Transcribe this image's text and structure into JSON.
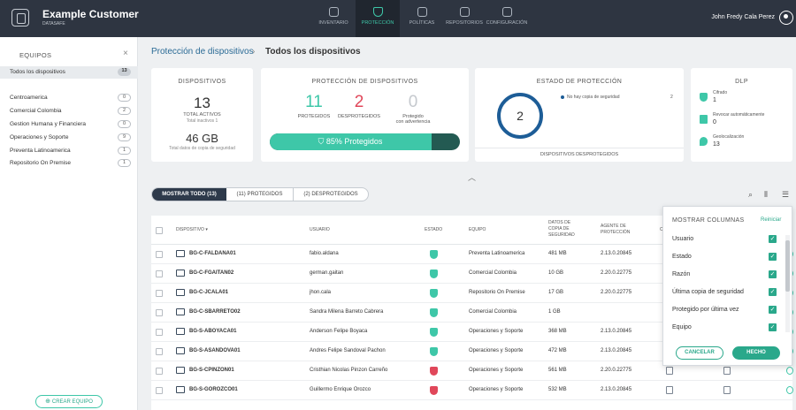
{
  "header": {
    "brand_name": "Example Customer",
    "brand_sub": "DATASAFE",
    "user_name": "John Fredy Cala Perez",
    "nav": [
      {
        "label": "INVENTARIO",
        "icon": "search-icon"
      },
      {
        "label": "PROTECCIÓN",
        "icon": "shield-icon"
      },
      {
        "label": "POLÍTICAS",
        "icon": "document-icon"
      },
      {
        "label": "REPOSITORIOS",
        "icon": "cloud-icon"
      },
      {
        "label": "CONFIGURACIÓN",
        "icon": "gear-icon"
      }
    ]
  },
  "sidebar": {
    "title": "EQUIPOS",
    "all_label": "Todos los dispositivos",
    "all_count": "13",
    "groups": [
      {
        "label": "Centroamerica",
        "count": "0"
      },
      {
        "label": "Comercial Colombia",
        "count": "2"
      },
      {
        "label": "Gestion Humana y Financiera",
        "count": "0"
      },
      {
        "label": "Operaciones y Soporte",
        "count": "9"
      },
      {
        "label": "Preventa Latinoamerica",
        "count": "1"
      },
      {
        "label": "Repositorio On Premise",
        "count": "1"
      }
    ],
    "create_label": "CREAR EQUIPO"
  },
  "breadcrumb": {
    "parent": "Protección de dispositivos",
    "sep": "›",
    "current": "Todos los dispositivos"
  },
  "cards": {
    "devices": {
      "title": "DISPOSITIVOS",
      "total": "13",
      "total_label": "TOTAL ACTIVOS",
      "inactive": "Total inactivos 1",
      "size": "46 GB",
      "size_label": "Total datos de copia de seguridad"
    },
    "protection": {
      "title": "PROTECCIÓN DE DISPOSITIVOS",
      "protected": "11",
      "protected_label": "PROTEGIDOS",
      "unprotected": "2",
      "unprotected_label": "DESPROTEGIDOS",
      "warning": "0",
      "warning_label1": "Protegido",
      "warning_label2": "con advertencia",
      "bar_text": "85% Protegidos",
      "bar_pct": 85
    },
    "state": {
      "title": "ESTADO DE PROTECCIÓN",
      "count": "2",
      "legend": "No hay copia de seguridad",
      "legend_value": "2",
      "footer": "DISPOSITIVOS DESPROTEGIDOS"
    },
    "dlp": {
      "title": "DLP",
      "items": [
        {
          "label": "Cifrado",
          "value": "1"
        },
        {
          "label": "Revocar automáticamente",
          "value": "0"
        },
        {
          "label": "Geolocalización",
          "value": "13"
        }
      ]
    }
  },
  "filters": {
    "tabs": [
      "MOSTRAR TODO (13)",
      "(11) PROTEGIDOS",
      "(2) DESPROTEGIDOS"
    ]
  },
  "table": {
    "headers": {
      "device": "DISPOSITIVO ▾",
      "user": "USUARIO",
      "status": "ESTADO",
      "team": "EQUIPO",
      "backup1": "DATOS DE",
      "backup2": "COPIA DE",
      "backup3": "SEGURIDAD",
      "agent1": "AGENTE DE",
      "agent2": "PROTECCIÓN",
      "extra": "C"
    },
    "rows": [
      {
        "device": "BG-C-FALDANA01",
        "user": "fabio.aldana",
        "status": "ok",
        "team": "Preventa Latinoamerica",
        "size": "481 MB",
        "agent": "2.13.0.20845"
      },
      {
        "device": "BG-C-FGAITAN02",
        "user": "german.gaitan",
        "status": "ok",
        "team": "Comercial Colombia",
        "size": "10 GB",
        "agent": "2.20.0.22775"
      },
      {
        "device": "BG-C-JCALA01",
        "user": "jhon.cala",
        "status": "ok",
        "team": "Repositorio On Premise",
        "size": "17 GB",
        "agent": "2.20.0.22775"
      },
      {
        "device": "BG-C-SBARRETO02",
        "user": "Sandra Milena Barreto Cabrera",
        "status": "ok",
        "team": "Comercial Colombia",
        "size": "1 GB",
        "agent": ""
      },
      {
        "device": "BG-S-ABOYACA01",
        "user": "Anderson Felipe Boyaca",
        "status": "ok",
        "team": "Operaciones y Soporte",
        "size": "368 MB",
        "agent": "2.13.0.20845"
      },
      {
        "device": "BG-S-ASANDOVA01",
        "user": "Andres Felipe Sandoval Pachon",
        "status": "ok",
        "team": "Operaciones y Soporte",
        "size": "472 MB",
        "agent": "2.13.0.20845"
      },
      {
        "device": "BG-S-CPINZON01",
        "user": "Cristhian Nicolas Pinzon Carreño",
        "status": "bad",
        "team": "Operaciones y Soporte",
        "size": "561 MB",
        "agent": "2.20.0.22775"
      },
      {
        "device": "BG-S-GOROZCO01",
        "user": "Guillermo Enrique Orozco",
        "status": "bad",
        "team": "Operaciones y Soporte",
        "size": "532 MB",
        "agent": "2.13.0.20845"
      }
    ]
  },
  "columns_panel": {
    "title": "MOSTRAR COLUMNAS",
    "reset": "Reiniciar",
    "items": [
      "Usuario",
      "Estado",
      "Razón",
      "Última copia de seguridad",
      "Protegido por última vez",
      "Equipo"
    ],
    "check": "✓",
    "cancel": "CANCELAR",
    "done": "HECHO"
  }
}
